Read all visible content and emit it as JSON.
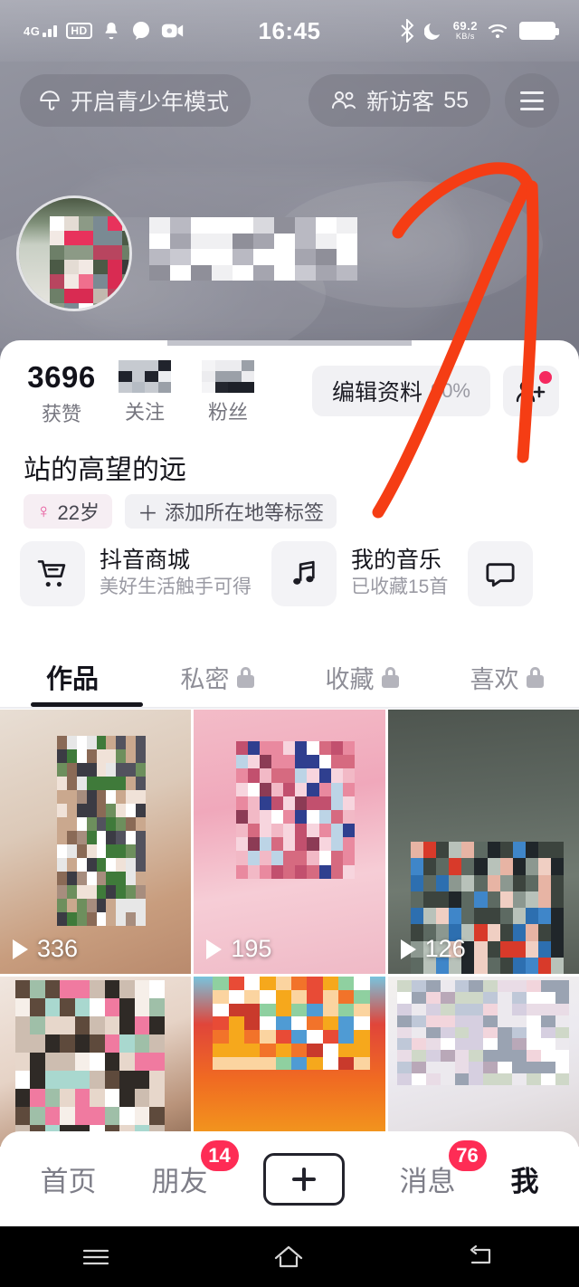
{
  "statusbar": {
    "network": "4G",
    "hd": "HD",
    "time": "16:45",
    "netspeed": "69.2",
    "netspeed_unit": "KB/s",
    "icons": [
      "signal-icon",
      "hd-icon",
      "bell-icon",
      "chat-icon",
      "video-icon",
      "bluetooth-icon",
      "moon-icon",
      "wifi-icon",
      "battery-icon"
    ]
  },
  "topbar": {
    "teen_mode_label": "开启青少年模式",
    "teen_mode_icon": "umbrella-icon",
    "visitors_label": "新访客",
    "visitors_count": "55",
    "visitors_icon": "people-icon",
    "menu_icon": "hamburger-icon"
  },
  "profile": {
    "avatar_name": "avatar",
    "username_masked": "",
    "display_name": "站的高望的远",
    "tags": [
      {
        "icon": "female-icon",
        "label": "22岁"
      },
      {
        "icon": "plus-icon",
        "label": "添加所在地等标签"
      }
    ]
  },
  "stats": [
    {
      "num": "3696",
      "label": "获赞",
      "masked": false
    },
    {
      "num": "",
      "label": "关注",
      "masked": true
    },
    {
      "num": "",
      "label": "粉丝",
      "masked": true
    }
  ],
  "actions": {
    "edit_label": "编辑资料",
    "edit_percent": "90%",
    "add_friend_icon": "add-friend-icon",
    "add_friend_badge": true
  },
  "cards": [
    {
      "icon": "cart-icon",
      "title": "抖音商城",
      "subtitle": "美好生活触手可得"
    },
    {
      "icon": "music-note-icon",
      "title": "我的音乐",
      "subtitle": "已收藏15首"
    },
    {
      "icon": "speech-bubble-icon",
      "title": "",
      "subtitle": ""
    }
  ],
  "tabs": [
    {
      "label": "作品",
      "locked": false,
      "active": true
    },
    {
      "label": "私密",
      "locked": true,
      "active": false
    },
    {
      "label": "收藏",
      "locked": true,
      "active": false
    },
    {
      "label": "喜欢",
      "locked": true,
      "active": false
    }
  ],
  "videos": [
    {
      "plays": "336",
      "row": 1
    },
    {
      "plays": "195",
      "row": 1
    },
    {
      "plays": "126",
      "row": 1
    },
    {
      "plays": "",
      "row": 2
    },
    {
      "plays": "",
      "row": 2
    },
    {
      "plays": "",
      "row": 2
    }
  ],
  "bottomnav": [
    {
      "label": "首页",
      "badge": "",
      "active": false
    },
    {
      "label": "朋友",
      "badge": "14",
      "active": false
    },
    {
      "label": "",
      "badge": "",
      "active": false,
      "icon": "plus-icon"
    },
    {
      "label": "消息",
      "badge": "76",
      "active": false
    },
    {
      "label": "我",
      "badge": "",
      "active": true
    }
  ],
  "sysnav": [
    "menu-icon",
    "home-icon",
    "back-icon"
  ],
  "colors": {
    "accent_red": "#fe2c55",
    "annotation_red": "#f53d14",
    "badge_pink": "#f5295f",
    "text_dark": "#16161d",
    "text_muted": "#9a9aa3",
    "cover_gradient_start": "#9698a3",
    "cover_gradient_end": "#767783"
  },
  "annotation": {
    "type": "hand-drawn-arrow",
    "color": "#f53d14"
  }
}
